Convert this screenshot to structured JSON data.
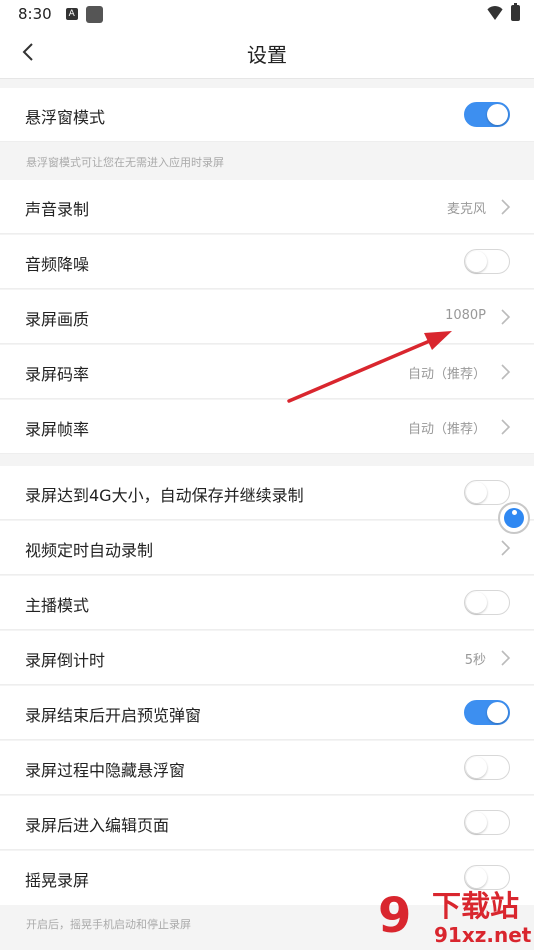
{
  "status_bar": {
    "time": "8:30",
    "notif_letter": "A"
  },
  "header": {
    "title": "设置"
  },
  "section1": {
    "float_window": {
      "label": "悬浮窗模式",
      "enabled": true
    },
    "hint": "悬浮窗模式可让您在无需进入应用时录屏"
  },
  "section2": {
    "audio_record": {
      "label": "声音录制",
      "value": "麦克风"
    },
    "noise_reduction": {
      "label": "音频降噪",
      "enabled": false
    },
    "quality": {
      "label": "录屏画质",
      "value": "1080P"
    },
    "bitrate": {
      "label": "录屏码率",
      "value": "自动（推荐）"
    },
    "framerate": {
      "label": "录屏帧率",
      "value": "自动（推荐）"
    }
  },
  "section3": {
    "auto_save_4g": {
      "label": "录屏达到4G大小，自动保存并继续录制",
      "enabled": false
    },
    "timed_record": {
      "label": "视频定时自动录制"
    },
    "anchor_mode": {
      "label": "主播模式",
      "enabled": false
    },
    "countdown": {
      "label": "录屏倒计时",
      "value": "5秒"
    },
    "preview_popup": {
      "label": "录屏结束后开启预览弹窗",
      "enabled": true
    },
    "hide_float": {
      "label": "录屏过程中隐藏悬浮窗",
      "enabled": false
    },
    "edit_after": {
      "label": "录屏后进入编辑页面",
      "enabled": false
    },
    "shake_record": {
      "label": "摇晃录屏",
      "enabled": false
    },
    "shake_hint": "开启后，摇晃手机启动和停止录屏"
  },
  "colors": {
    "accent": "#3d8ff0",
    "annotation_arrow": "#d9262e"
  },
  "watermark": {
    "mark": "9",
    "title": "下载站",
    "url": "91xz.net"
  }
}
